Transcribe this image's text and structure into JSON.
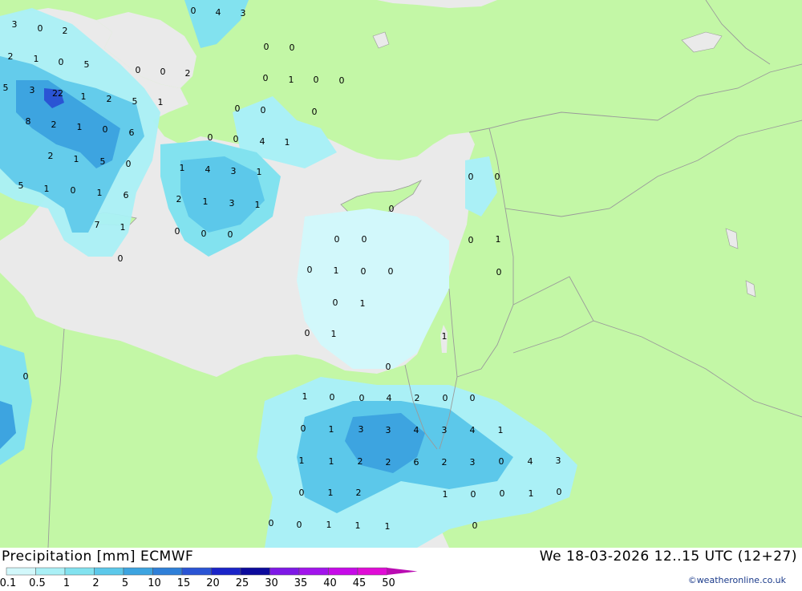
{
  "header": {
    "title": "Precipitation [mm] ECMWF",
    "datetime": "We 18-03-2026 12..15 UTC (12+27)",
    "credit": "©weatheronline.co.uk"
  },
  "colors": {
    "land": "#c3f7a6",
    "sea": "#eaeaea",
    "border": "#9a9a9a",
    "scale": [
      "#d2f8fb",
      "#aaf0f6",
      "#82e2ef",
      "#5cc8ea",
      "#3da4e0",
      "#2f7fd8",
      "#2a54d4",
      "#1a24c8",
      "#0c0a9c",
      "#7e18e6",
      "#a214ec",
      "#c60ae8",
      "#e00cd6",
      "#ba0cb2"
    ]
  },
  "legend": {
    "labels": [
      "0.1",
      "0.5",
      "1",
      "2",
      "5",
      "10",
      "15",
      "20",
      "25",
      "30",
      "35",
      "40",
      "45",
      "50"
    ]
  },
  "map_values": [
    {
      "v": "3"
    },
    {
      "v": "0"
    },
    {
      "v": "2"
    },
    {
      "v": "0"
    },
    {
      "v": "4"
    },
    {
      "v": "3"
    },
    {
      "v": "2"
    },
    {
      "v": "1"
    },
    {
      "v": "0"
    },
    {
      "v": "5"
    },
    {
      "v": "0"
    },
    {
      "v": "0"
    },
    {
      "v": "2"
    },
    {
      "v": "0"
    },
    {
      "v": "0"
    },
    {
      "v": "0"
    },
    {
      "v": "1"
    },
    {
      "v": "0"
    },
    {
      "v": "0"
    },
    {
      "v": "5"
    },
    {
      "v": "3"
    },
    {
      "v": "22"
    },
    {
      "v": "1"
    },
    {
      "v": "2"
    },
    {
      "v": "5"
    },
    {
      "v": "1"
    },
    {
      "v": "0"
    },
    {
      "v": "0"
    },
    {
      "v": "0"
    },
    {
      "v": "8"
    },
    {
      "v": "2"
    },
    {
      "v": "1"
    },
    {
      "v": "0"
    },
    {
      "v": "6"
    },
    {
      "v": "0"
    },
    {
      "v": "0"
    },
    {
      "v": "4"
    },
    {
      "v": "1"
    },
    {
      "v": "2"
    },
    {
      "v": "1"
    },
    {
      "v": "5"
    },
    {
      "v": "0"
    },
    {
      "v": "1"
    },
    {
      "v": "4"
    },
    {
      "v": "3"
    },
    {
      "v": "1"
    },
    {
      "v": "0"
    },
    {
      "v": "0"
    },
    {
      "v": "5"
    },
    {
      "v": "1"
    },
    {
      "v": "0"
    },
    {
      "v": "1"
    },
    {
      "v": "6"
    },
    {
      "v": "2"
    },
    {
      "v": "1"
    },
    {
      "v": "3"
    },
    {
      "v": "1"
    },
    {
      "v": "0"
    },
    {
      "v": "7"
    },
    {
      "v": "1"
    },
    {
      "v": "0"
    },
    {
      "v": "0"
    },
    {
      "v": "0"
    },
    {
      "v": "0"
    },
    {
      "v": "0"
    },
    {
      "v": "0"
    },
    {
      "v": "1"
    },
    {
      "v": "0"
    },
    {
      "v": "0"
    },
    {
      "v": "1"
    },
    {
      "v": "0"
    },
    {
      "v": "0"
    },
    {
      "v": "0"
    },
    {
      "v": "0"
    },
    {
      "v": "1"
    },
    {
      "v": "0"
    },
    {
      "v": "1"
    },
    {
      "v": "1"
    },
    {
      "v": "0"
    },
    {
      "v": "1"
    },
    {
      "v": "0"
    },
    {
      "v": "0"
    },
    {
      "v": "4"
    },
    {
      "v": "2"
    },
    {
      "v": "0"
    },
    {
      "v": "0"
    },
    {
      "v": "0"
    },
    {
      "v": "0"
    },
    {
      "v": "1"
    },
    {
      "v": "3"
    },
    {
      "v": "3"
    },
    {
      "v": "4"
    },
    {
      "v": "3"
    },
    {
      "v": "4"
    },
    {
      "v": "1"
    },
    {
      "v": "1"
    },
    {
      "v": "1"
    },
    {
      "v": "2"
    },
    {
      "v": "2"
    },
    {
      "v": "6"
    },
    {
      "v": "2"
    },
    {
      "v": "3"
    },
    {
      "v": "0"
    },
    {
      "v": "4"
    },
    {
      "v": "3"
    },
    {
      "v": "0"
    },
    {
      "v": "1"
    },
    {
      "v": "2"
    },
    {
      "v": "1"
    },
    {
      "v": "0"
    },
    {
      "v": "0"
    },
    {
      "v": "1"
    },
    {
      "v": "0"
    },
    {
      "v": "0"
    },
    {
      "v": "0"
    },
    {
      "v": "1"
    },
    {
      "v": "1"
    },
    {
      "v": "1"
    },
    {
      "v": "0"
    },
    {
      "v": "0"
    }
  ]
}
